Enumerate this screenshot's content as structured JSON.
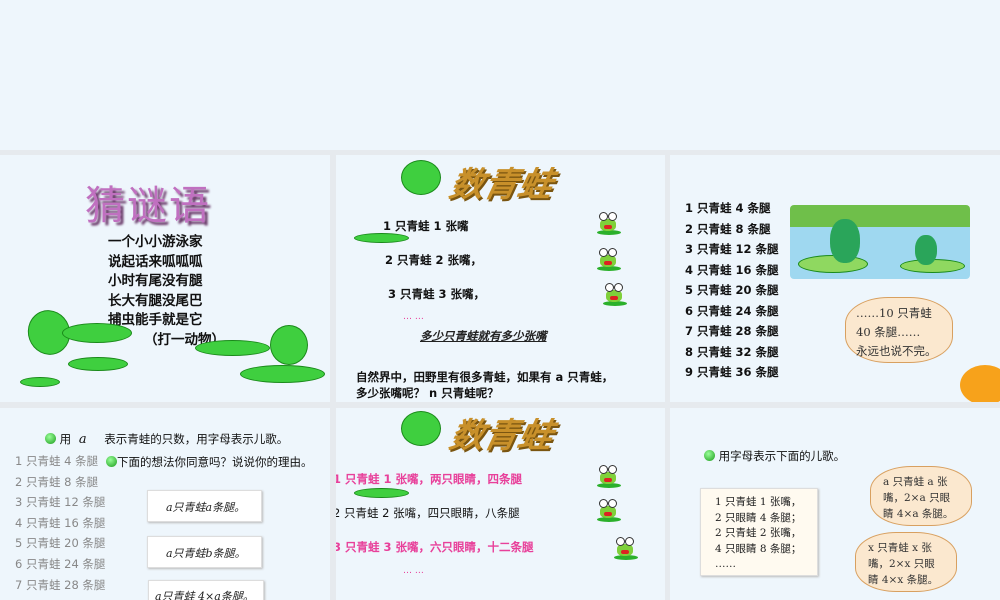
{
  "slide1": {
    "title": "猜谜语",
    "lines": [
      "一个小小游泳家",
      "说起话来呱呱呱",
      "小时有尾没有腿",
      "长大有腿没尾巴",
      "捕虫能手就是它",
      "（打一动物）"
    ]
  },
  "slide2": {
    "title": "数青蛙",
    "lines": [
      "1 只青蛙 1 张嘴",
      "2 只青蛙 2 张嘴，",
      "3 只青蛙 3 张嘴，"
    ],
    "ellipsis": "… …",
    "summary": "多少只青蛙就有多少张嘴",
    "question1": "自然界中，田野里有很多青蛙，如果有 a 只青蛙，",
    "question2": "多少张嘴呢？ n 只青蛙呢？"
  },
  "slide3": {
    "lines": [
      "1 只青蛙 4 条腿",
      "2 只青蛙 8 条腿",
      "3 只青蛙 12 条腿",
      "4 只青蛙 16 条腿",
      "5 只青蛙 20 条腿",
      "6 只青蛙 24 条腿",
      "7 只青蛙 28 条腿",
      "8 只青蛙 32 条腿",
      "9 只青蛙 36 条腿"
    ],
    "bubble": [
      "……10 只青蛙",
      "40 条腿……",
      "永远也说不完。"
    ]
  },
  "slide4": {
    "prompt_a": "用",
    "prompt_var": "a",
    "prompt_b": "表示青蛙的只数，用字母表示儿歌。",
    "prompt2": "下面的想法你同意吗？说说你的理由。",
    "lines": [
      "1 只青蛙 4 条腿",
      "2 只青蛙 8 条腿",
      "3 只青蛙 12 条腿",
      "4 只青蛙 16 条腿",
      "5 只青蛙 20 条腿",
      "6 只青蛙 24 条腿",
      "7 只青蛙 28 条腿"
    ],
    "notes": [
      "a只青蛙a条腿。",
      "a只青蛙b条腿。",
      "a只青蛙 4×a条腿。"
    ]
  },
  "slide5": {
    "title": "数青蛙",
    "lines": [
      "1 只青蛙 1 张嘴，两只眼睛，四条腿",
      "2 只青蛙 2 张嘴，四只眼睛，八条腿",
      "3 只青蛙 3 张嘴，六只眼睛，十二条腿"
    ],
    "ellipsis": "… …"
  },
  "slide6": {
    "prompt": "用字母表示下面的儿歌。",
    "note": [
      "1 只青蛙 1 张嘴，",
      "2 只眼睛 4 条腿；",
      "2 只青蛙 2 张嘴，",
      "4 只眼睛 8 条腿；",
      "……"
    ],
    "bubble1": [
      "a 只青蛙 a 张",
      "嘴，2×a 只眼",
      "睛 4×a 条腿。"
    ],
    "bubble2": [
      "x 只青蛙 x 张",
      "嘴，2×x 只眼",
      "睛 4×x 条腿。"
    ]
  },
  "colors": {
    "pink": "#e8409a",
    "background": "#eef6fc"
  }
}
